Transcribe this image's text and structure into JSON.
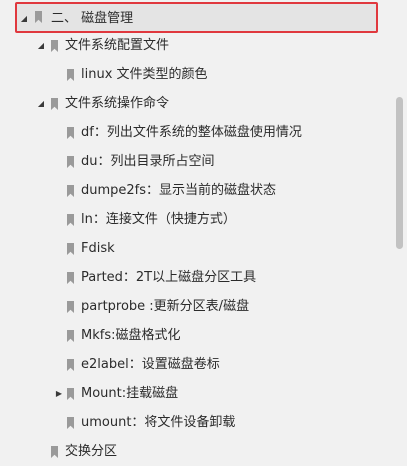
{
  "icons": {
    "bookmark": "bookmark-icon",
    "expanded": "caret-down-icon",
    "collapsed": "caret-right-icon"
  },
  "colors": {
    "selection_border": "#e0383e",
    "selection_fill": "#e4e4e4",
    "bookmark": "#9a9a9a",
    "text": "#2b2b2b",
    "panel": "#f1f1f1",
    "scroll_thumb": "#c2c2c2"
  },
  "tree": [
    {
      "label": "二、 磁盘管理",
      "depth": 0,
      "toggle": "expanded",
      "selected": true
    },
    {
      "label": "文件系统配置文件",
      "depth": 1,
      "toggle": "expanded",
      "selected": false
    },
    {
      "label": "linux 文件类型的颜色",
      "depth": 2,
      "toggle": "none",
      "selected": false
    },
    {
      "label": "文件系统操作命令",
      "depth": 1,
      "toggle": "expanded",
      "selected": false
    },
    {
      "label": "df：列出文件系统的整体磁盘使用情况",
      "depth": 2,
      "toggle": "none",
      "selected": false
    },
    {
      "label": "du：列出目录所占空间",
      "depth": 2,
      "toggle": "none",
      "selected": false
    },
    {
      "label": "dumpe2fs：显示当前的磁盘状态",
      "depth": 2,
      "toggle": "none",
      "selected": false
    },
    {
      "label": "ln：连接文件（快捷方式）",
      "depth": 2,
      "toggle": "none",
      "selected": false
    },
    {
      "label": "Fdisk",
      "depth": 2,
      "toggle": "none",
      "selected": false
    },
    {
      "label": "Parted：2T以上磁盘分区工具",
      "depth": 2,
      "toggle": "none",
      "selected": false
    },
    {
      "label": "partprobe :更新分区表/磁盘",
      "depth": 2,
      "toggle": "none",
      "selected": false
    },
    {
      "label": "Mkfs:磁盘格式化",
      "depth": 2,
      "toggle": "none",
      "selected": false
    },
    {
      "label": "e2label：设置磁盘卷标",
      "depth": 2,
      "toggle": "none",
      "selected": false
    },
    {
      "label": "Mount:挂载磁盘",
      "depth": 2,
      "toggle": "collapsed",
      "selected": false
    },
    {
      "label": "umount：将文件设备卸载",
      "depth": 2,
      "toggle": "none",
      "selected": false
    },
    {
      "label": "交换分区",
      "depth": 1,
      "toggle": "none",
      "selected": false
    }
  ]
}
